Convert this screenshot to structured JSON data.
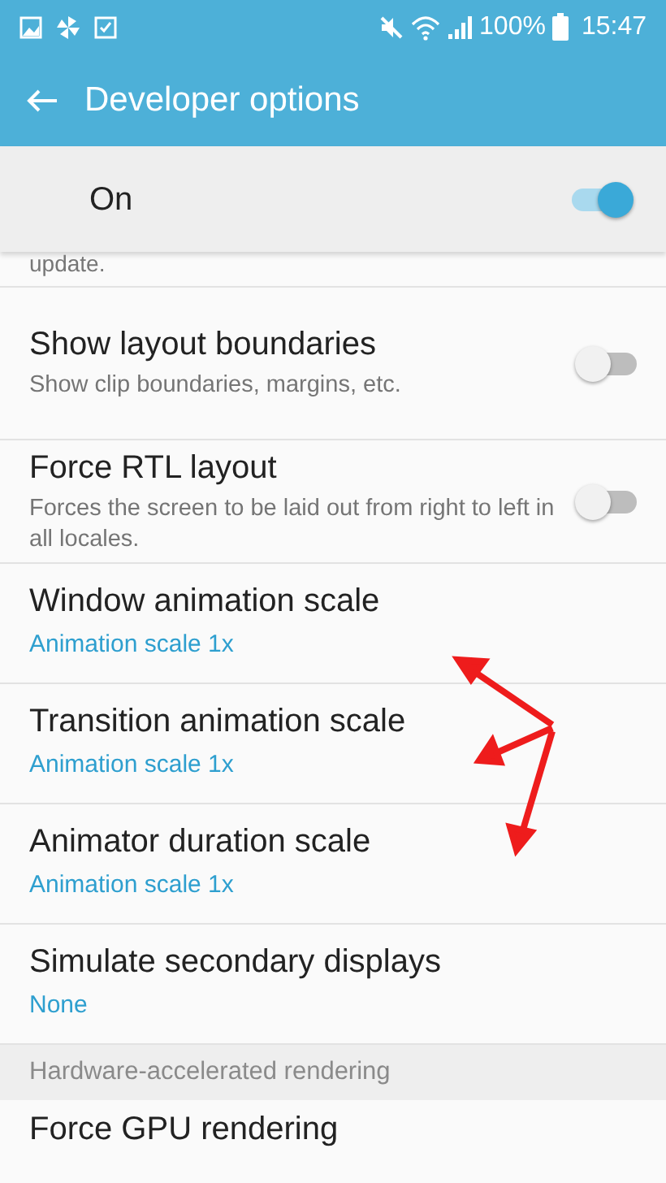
{
  "status_bar": {
    "battery_text": "100%",
    "time": "15:47"
  },
  "toolbar": {
    "title": "Developer options"
  },
  "master_switch": {
    "label": "On",
    "on": true
  },
  "partial_summary": "update.",
  "items": [
    {
      "kind": "switch",
      "title": "Show layout boundaries",
      "summary": "Show clip boundaries, margins, etc.",
      "on": false
    },
    {
      "kind": "switch",
      "title": "Force RTL layout",
      "summary": "Forces the screen to be laid out from right to left in all locales.",
      "on": false
    },
    {
      "kind": "value",
      "title": "Window animation scale",
      "value": "Animation scale 1x"
    },
    {
      "kind": "value",
      "title": "Transition animation scale",
      "value": "Animation scale 1x"
    },
    {
      "kind": "value",
      "title": "Animator duration scale",
      "value": "Animation scale 1x"
    },
    {
      "kind": "value",
      "title": "Simulate secondary displays",
      "value": "None"
    }
  ],
  "section_header": "Hardware-accelerated rendering",
  "next_item": {
    "title": "Force GPU rendering"
  }
}
